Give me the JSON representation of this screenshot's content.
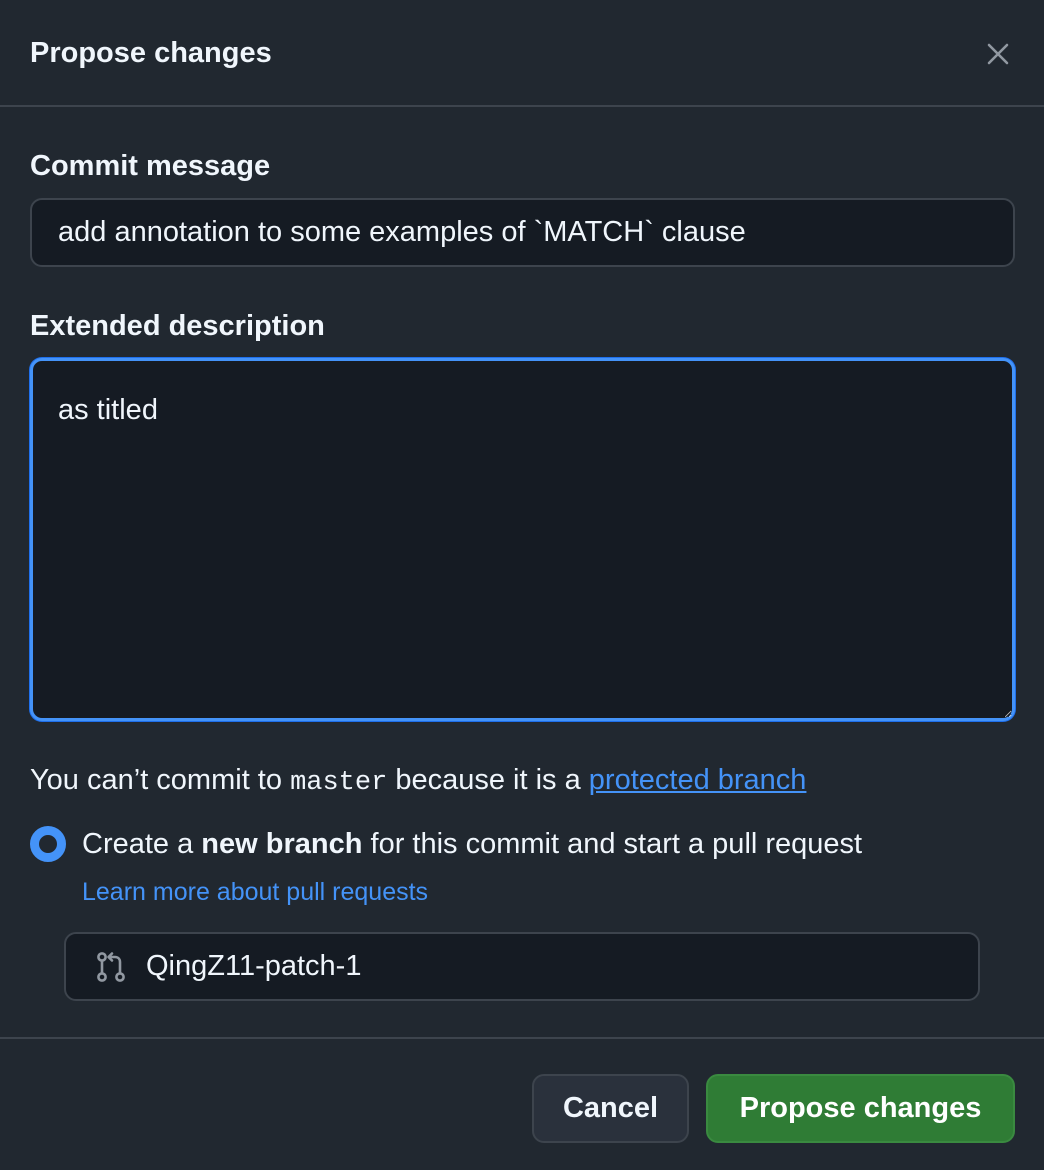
{
  "dialog": {
    "title": "Propose changes",
    "close_icon": "close-icon"
  },
  "commit": {
    "label": "Commit message",
    "value": "add annotation to some examples of `MATCH` clause"
  },
  "description": {
    "label": "Extended description",
    "value": "as titled"
  },
  "protection": {
    "prefix": "You can’t commit to ",
    "branch": "master",
    "middle": " because it is a ",
    "link": "protected branch"
  },
  "new_branch_option": {
    "selected": true,
    "text_before": "Create a ",
    "text_bold": "new branch",
    "text_after": " for this commit and start a pull request",
    "learn_more": "Learn more about pull requests"
  },
  "branch": {
    "icon": "git-pull-request-icon",
    "value": "QingZ11-patch-1"
  },
  "footer": {
    "cancel_label": "Cancel",
    "propose_label": "Propose changes"
  },
  "colors": {
    "background": "#212830",
    "input_background": "#151b23",
    "accent": "#4493f8",
    "primary_button": "#2f7c35"
  }
}
